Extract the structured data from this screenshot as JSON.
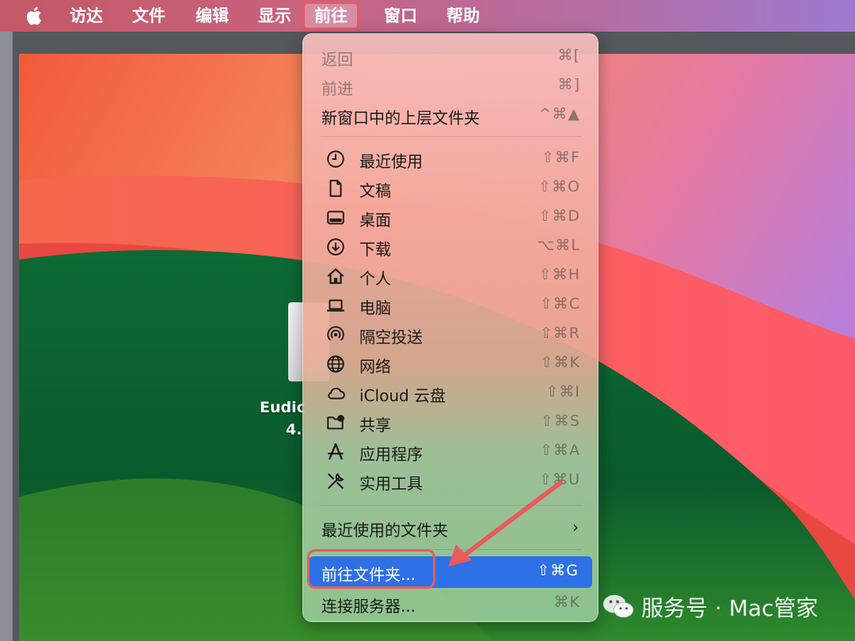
{
  "menubar": {
    "items": [
      "访达",
      "文件",
      "编辑",
      "显示",
      "前往",
      "窗口",
      "帮助"
    ],
    "active": "前往"
  },
  "desktop_app": {
    "name_line1": "Eudic",
    "name_line2": "4."
  },
  "menu": {
    "top_items": [
      {
        "label": "返回",
        "shortcut": "⌘[",
        "disabled": true
      },
      {
        "label": "前进",
        "shortcut": "⌘]",
        "disabled": true
      },
      {
        "label": "新窗口中的上层文件夹",
        "shortcut": "^⌘▲",
        "disabled": false
      }
    ],
    "places": [
      {
        "label": "最近使用",
        "shortcut": "⇧⌘F",
        "icon": "clock-icon"
      },
      {
        "label": "文稿",
        "shortcut": "⇧⌘O",
        "icon": "document-icon"
      },
      {
        "label": "桌面",
        "shortcut": "⇧⌘D",
        "icon": "desktop-icon"
      },
      {
        "label": "下载",
        "shortcut": "⌥⌘L",
        "icon": "download-icon"
      },
      {
        "label": "个人",
        "shortcut": "⇧⌘H",
        "icon": "home-icon"
      },
      {
        "label": "电脑",
        "shortcut": "⇧⌘C",
        "icon": "laptop-icon"
      },
      {
        "label": "隔空投送",
        "shortcut": "⇧⌘R",
        "icon": "airdrop-icon"
      },
      {
        "label": "网络",
        "shortcut": "⇧⌘K",
        "icon": "globe-icon"
      },
      {
        "label": "iCloud 云盘",
        "shortcut": "⇧⌘I",
        "icon": "cloud-icon"
      },
      {
        "label": "共享",
        "shortcut": "⇧⌘S",
        "icon": "shared-folder-icon"
      },
      {
        "label": "应用程序",
        "shortcut": "⇧⌘A",
        "icon": "applications-icon"
      },
      {
        "label": "实用工具",
        "shortcut": "⇧⌘U",
        "icon": "utilities-icon"
      }
    ],
    "recent_folders": {
      "label": "最近使用的文件夹",
      "chevron": "›"
    },
    "goto_folder": {
      "label": "前往文件夹...",
      "shortcut": "⇧⌘G"
    },
    "connect_server": {
      "label": "连接服务器...",
      "shortcut": "⌘K"
    }
  },
  "watermark": {
    "text": "服务号 · Mac管家"
  },
  "colors": {
    "highlight": "#2e71e6",
    "callout": "#e85b5b",
    "menubar_start": "#c35866",
    "menubar_end": "#9d7ad0"
  }
}
